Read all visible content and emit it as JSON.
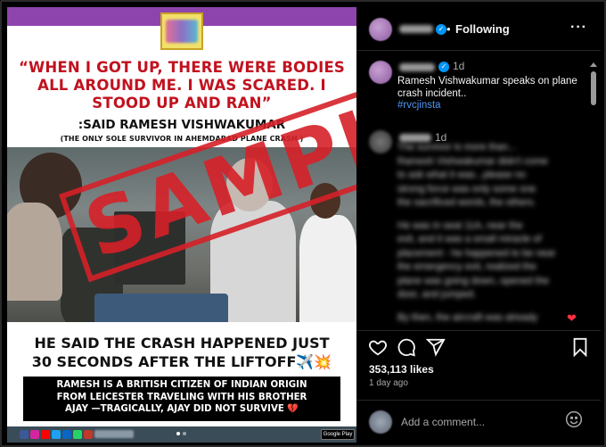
{
  "post_image": {
    "quote_lines": [
      "“WHEN I GOT UP, THERE WERE BODIES",
      "ALL AROUND ME. I WAS SCARED. I",
      "STOOD UP AND RAN”"
    ],
    "said_by": ":SAID RAMESH VISHWAKUMAR",
    "survivor_note": "(THE ONLY SOLE SURVIVOR IN AHEMDABAD PLANE CRASH )",
    "watermark": "SAMPLE",
    "headline_lines": [
      "HE SAID THE CRASH HAPPENED JUST",
      "30 SECONDS AFTER THE LIFTOFF✈️💥"
    ],
    "info_lines": [
      "RAMESH IS A BRITISH CITIZEN OF INDIAN ORIGIN",
      "FROM LEICESTER TRAVELING WITH HIS BROTHER",
      "AJAY —TRAGICALLY, AJAY DID NOT SURVIVE 💔"
    ],
    "store_badge": "Google Play"
  },
  "header": {
    "dot": "•",
    "following_label": "Following",
    "more_label": "···"
  },
  "caption": {
    "time": "1d",
    "text_lines": [
      "Ramesh Vishwakumar speaks on plane",
      "crash incident.."
    ],
    "hashtag": "#rvcjinsta"
  },
  "comment2": {
    "time": "1d",
    "blurred_lines": [
      "The survivor is more than...",
      "Ramesh Vishwakumar didn't come",
      "to ask what it was...please no",
      "strong force was only some one",
      "the sacrificed words, the others.",
      "",
      "He was in seat 11A, near the",
      "exit, and it was a small miracle of",
      "placement - he happened to be near",
      "the emergency exit, realized the",
      "plane was going down, opened the",
      "door, and jumped.",
      "",
      "By then, the aircraft was already"
    ]
  },
  "stats": {
    "likes": "353,113 likes",
    "ago": "1 day ago"
  },
  "comment_box": {
    "placeholder": "Add a comment..."
  },
  "icons": [
    "verified-icon",
    "heart-icon",
    "comment-icon",
    "share-icon",
    "save-icon",
    "emoji-icon",
    "scroll-up-icon"
  ],
  "colors": {
    "quote_red": "#c1121f",
    "stamp_red": "#d62028",
    "hashtag_blue": "#4e95f5",
    "verified_blue": "#0095f6",
    "like_red": "#ff3040"
  }
}
